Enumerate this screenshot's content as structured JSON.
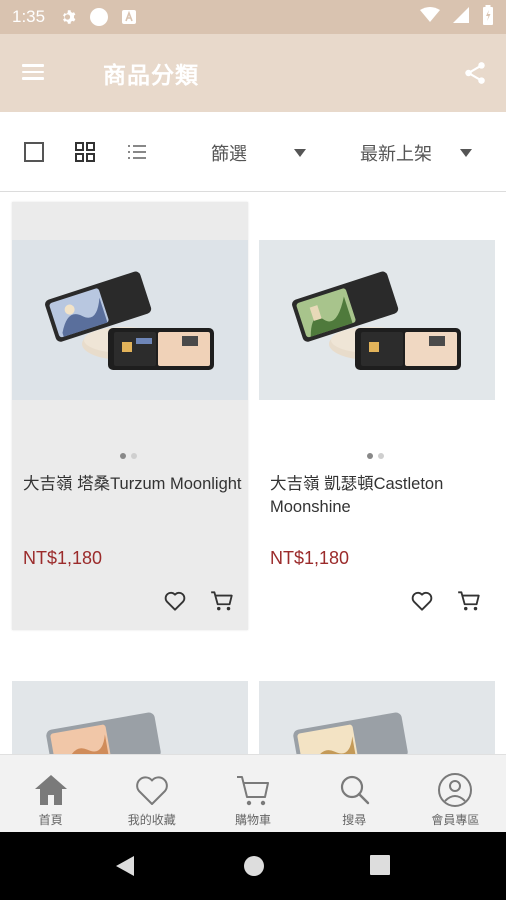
{
  "status_bar": {
    "time": "1:35",
    "icons": [
      "settings-icon",
      "circle-icon",
      "a-badge-icon",
      "wifi-icon",
      "signal-icon",
      "battery-icon"
    ]
  },
  "app_bar": {
    "title": "商品分類",
    "menu_icon": "hamburger-menu-icon",
    "share_icon": "share-icon",
    "background_color": "#e8d9cb"
  },
  "toolbar": {
    "view_modes": [
      "single-view-icon",
      "grid-view-icon",
      "list-view-icon"
    ],
    "filter_label": "篩選",
    "sort_label": "最新上架"
  },
  "products": [
    {
      "name": "大吉嶺 塔桑Turzum Moonlight",
      "price": "NT$1,180",
      "image_slides": 2,
      "active_slide": 1,
      "selected": true,
      "label_accent": "#b8c7e0"
    },
    {
      "name": "大吉嶺 凱瑟頓Castleton Moonshine",
      "price": "NT$1,180",
      "image_slides": 2,
      "active_slide": 1,
      "selected": false,
      "label_accent": "#a8c48c"
    }
  ],
  "bottom_nav": [
    {
      "label": "首頁",
      "icon": "home-icon",
      "active": true
    },
    {
      "label": "我的收藏",
      "icon": "heart-icon",
      "active": false
    },
    {
      "label": "購物車",
      "icon": "cart-icon",
      "active": false
    },
    {
      "label": "搜尋",
      "icon": "search-icon",
      "active": false
    },
    {
      "label": "會員專區",
      "icon": "user-icon",
      "active": false
    }
  ],
  "colors": {
    "accent": "#e8d9cb",
    "status_bar": "#d9c3b0",
    "price": "#9b2b2b",
    "nav_active": "#7a7a7a"
  }
}
